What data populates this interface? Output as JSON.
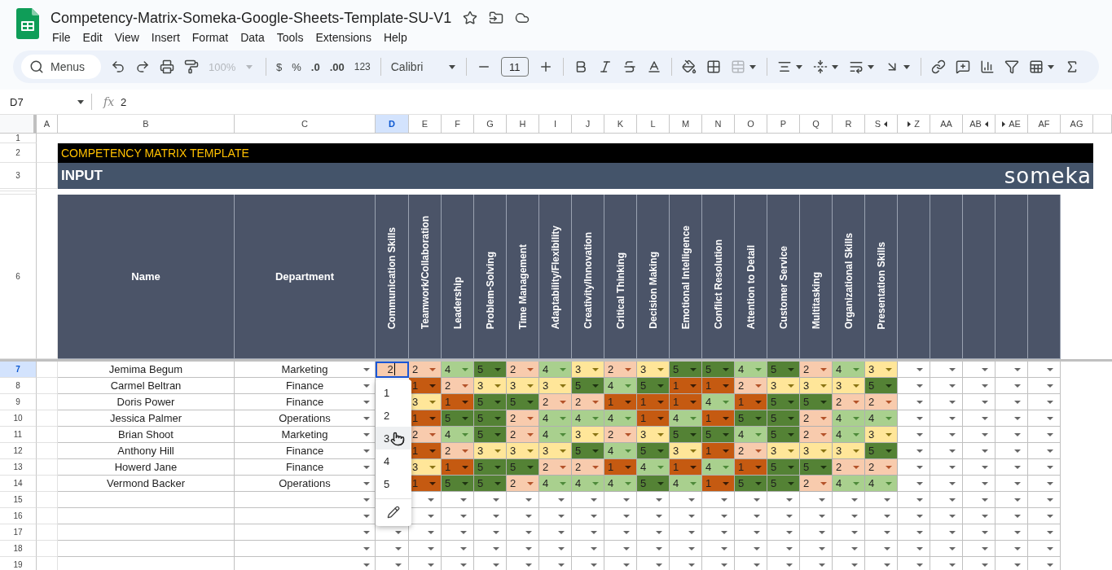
{
  "app": {
    "title": "Competency-Matrix-Someka-Google-Sheets-Template-SU-V1",
    "menus": [
      "File",
      "Edit",
      "View",
      "Insert",
      "Format",
      "Data",
      "Tools",
      "Extensions",
      "Help"
    ]
  },
  "toolbar": {
    "search": "Menus",
    "zoom": "100%",
    "zoom_disabled": true,
    "currency": "$",
    "percent": "%",
    "decrease_decimal": ".0",
    "increase_decimal": ".00",
    "number_format": "123",
    "font": "Calibri",
    "font_size": "11"
  },
  "formula_bar": {
    "cell": "D7",
    "fx": "fx",
    "value": "2"
  },
  "columns": [
    {
      "label": "A",
      "selected": false,
      "hidden_before": false,
      "hidden_after": false
    },
    {
      "label": "B",
      "selected": false,
      "hidden_before": false,
      "hidden_after": false
    },
    {
      "label": "C",
      "selected": false,
      "hidden_before": false,
      "hidden_after": false
    },
    {
      "label": "D",
      "selected": true,
      "hidden_before": false,
      "hidden_after": false
    },
    {
      "label": "E",
      "selected": false,
      "hidden_before": false,
      "hidden_after": false
    },
    {
      "label": "F",
      "selected": false,
      "hidden_before": false,
      "hidden_after": false
    },
    {
      "label": "G",
      "selected": false,
      "hidden_before": false,
      "hidden_after": false
    },
    {
      "label": "H",
      "selected": false,
      "hidden_before": false,
      "hidden_after": false
    },
    {
      "label": "I",
      "selected": false,
      "hidden_before": false,
      "hidden_after": false
    },
    {
      "label": "J",
      "selected": false,
      "hidden_before": false,
      "hidden_after": false
    },
    {
      "label": "K",
      "selected": false,
      "hidden_before": false,
      "hidden_after": false
    },
    {
      "label": "L",
      "selected": false,
      "hidden_before": false,
      "hidden_after": false
    },
    {
      "label": "M",
      "selected": false,
      "hidden_before": false,
      "hidden_after": false
    },
    {
      "label": "N",
      "selected": false,
      "hidden_before": false,
      "hidden_after": false
    },
    {
      "label": "O",
      "selected": false,
      "hidden_before": false,
      "hidden_after": false
    },
    {
      "label": "P",
      "selected": false,
      "hidden_before": false,
      "hidden_after": false
    },
    {
      "label": "Q",
      "selected": false,
      "hidden_before": false,
      "hidden_after": false
    },
    {
      "label": "R",
      "selected": false,
      "hidden_before": false,
      "hidden_after": false
    },
    {
      "label": "S",
      "selected": false,
      "hidden_before": false,
      "hidden_after": true
    },
    {
      "label": "Z",
      "selected": false,
      "hidden_before": true,
      "hidden_after": false
    },
    {
      "label": "AA",
      "selected": false,
      "hidden_before": false,
      "hidden_after": false
    },
    {
      "label": "AB",
      "selected": false,
      "hidden_before": false,
      "hidden_after": true
    },
    {
      "label": "AE",
      "selected": false,
      "hidden_before": true,
      "hidden_after": false
    },
    {
      "label": "AF",
      "selected": false,
      "hidden_before": false,
      "hidden_after": false
    },
    {
      "label": "AG",
      "selected": false,
      "hidden_before": false,
      "hidden_after": false
    }
  ],
  "sheet": {
    "row_numbers": {
      "r1": "1",
      "r2": "2",
      "r3": "3",
      "r6": "6"
    },
    "banner": "COMPETENCY MATRIX TEMPLATE",
    "section": "INPUT",
    "logo": "someka",
    "headers": {
      "name": "Name",
      "department": "Department",
      "skills": [
        "Communication Skills",
        "Teamwork/Collaboration",
        "Leadership",
        "Problem-Solving",
        "Time Management",
        "Adaptability/Flexibility",
        "Creativity/Innovation",
        "Critical Thinking",
        "Decision Making",
        "Emotional Intelligence",
        "Conflict Resolution",
        "Attention to Detail",
        "Customer Service",
        "Multitasking",
        "Organizational Skills",
        "Presentation Skills"
      ]
    },
    "rows": [
      {
        "number": "7",
        "selected": true,
        "name": "Jemima Begum",
        "department": "Marketing",
        "scores": [
          "2",
          "2",
          "4",
          "5",
          "2",
          "4",
          "3",
          "2",
          "3",
          "5",
          "5",
          "4",
          "5",
          "2",
          "4",
          "3"
        ]
      },
      {
        "number": "8",
        "selected": false,
        "name": "Carmel Beltran",
        "department": "Finance",
        "scores": [
          "1",
          "2",
          "3",
          "3",
          "3",
          "5",
          "4",
          "5",
          "1",
          "1",
          "2",
          "3",
          "3",
          "3",
          "5"
        ]
      },
      {
        "number": "9",
        "selected": false,
        "name": "Doris Power",
        "department": "Finance",
        "scores": [
          "3",
          "1",
          "5",
          "5",
          "2",
          "2",
          "1",
          "1",
          "1",
          "4",
          "1",
          "5",
          "5",
          "2",
          "2"
        ]
      },
      {
        "number": "10",
        "selected": false,
        "name": "Jessica Palmer",
        "department": "Operations",
        "scores": [
          "1",
          "5",
          "5",
          "2",
          "4",
          "4",
          "4",
          "1",
          "4",
          "1",
          "5",
          "5",
          "2",
          "4",
          "4"
        ]
      },
      {
        "number": "11",
        "selected": false,
        "name": "Brian Shoot",
        "department": "Marketing",
        "scores": [
          "2",
          "4",
          "5",
          "2",
          "4",
          "3",
          "2",
          "3",
          "5",
          "5",
          "4",
          "5",
          "2",
          "4",
          "3"
        ]
      },
      {
        "number": "12",
        "selected": false,
        "name": "Anthony Hill",
        "department": "Finance",
        "scores": [
          "1",
          "2",
          "3",
          "3",
          "3",
          "5",
          "4",
          "5",
          "3",
          "1",
          "2",
          "3",
          "3",
          "3",
          "5"
        ]
      },
      {
        "number": "13",
        "selected": false,
        "name": "Howerd Jane",
        "department": "Finance",
        "scores": [
          "3",
          "1",
          "5",
          "5",
          "2",
          "2",
          "1",
          "4",
          "1",
          "4",
          "1",
          "5",
          "5",
          "2",
          "2"
        ]
      },
      {
        "number": "14",
        "selected": false,
        "name": "Vermond Backer",
        "department": "Operations",
        "scores": [
          "1",
          "5",
          "5",
          "2",
          "4",
          "4",
          "4",
          "5",
          "4",
          "1",
          "5",
          "5",
          "2",
          "4",
          "4"
        ]
      }
    ],
    "empty_rows": [
      {
        "number": "15"
      },
      {
        "number": "16"
      },
      {
        "number": "17"
      },
      {
        "number": "18"
      },
      {
        "number": "19"
      }
    ]
  },
  "menu": {
    "options": [
      {
        "label": "1",
        "hovered": false
      },
      {
        "label": "2",
        "hovered": false
      },
      {
        "label": "3",
        "hovered": true
      },
      {
        "label": "4",
        "hovered": false
      },
      {
        "label": "5",
        "hovered": false
      }
    ]
  }
}
